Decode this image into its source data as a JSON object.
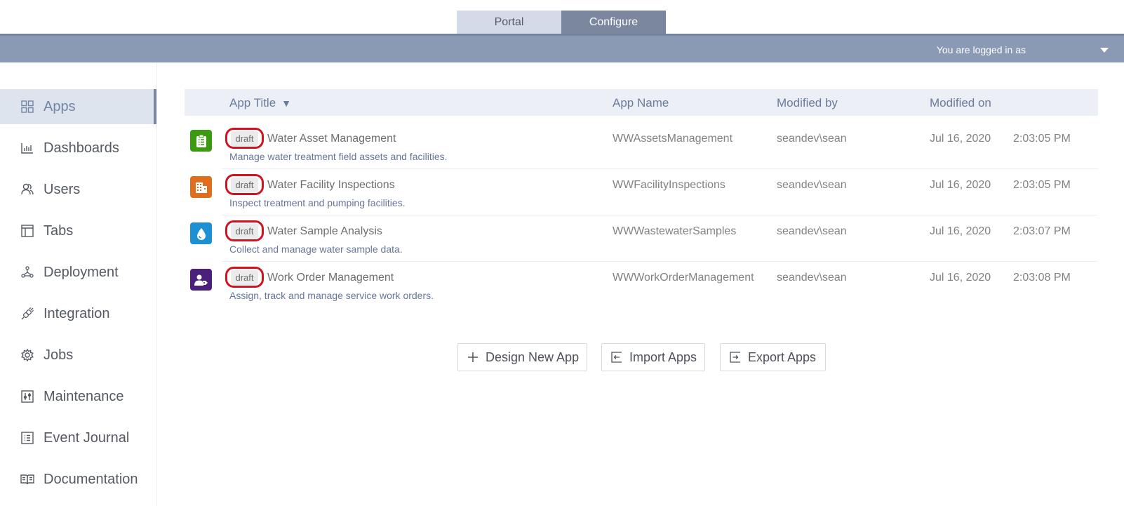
{
  "topnav": {
    "tabs": [
      {
        "label": "Portal",
        "active": false
      },
      {
        "label": "Configure",
        "active": true
      }
    ]
  },
  "header": {
    "login_text": "You are logged in as",
    "dropdown_icon": "caret-down-icon"
  },
  "sidebar": {
    "items": [
      {
        "label": "Apps",
        "icon": "grid-icon",
        "active": true
      },
      {
        "label": "Dashboards",
        "icon": "bar-chart-icon",
        "active": false
      },
      {
        "label": "Users",
        "icon": "users-icon",
        "active": false
      },
      {
        "label": "Tabs",
        "icon": "layout-icon",
        "active": false
      },
      {
        "label": "Deployment",
        "icon": "network-icon",
        "active": false
      },
      {
        "label": "Integration",
        "icon": "plug-icon",
        "active": false
      },
      {
        "label": "Jobs",
        "icon": "gear-icon",
        "active": false
      },
      {
        "label": "Maintenance",
        "icon": "sliders-icon",
        "active": false
      },
      {
        "label": "Event Journal",
        "icon": "list-icon",
        "active": false
      },
      {
        "label": "Documentation",
        "icon": "book-icon",
        "active": false
      }
    ]
  },
  "table": {
    "columns": {
      "title": "App Title",
      "title_sort": "▼",
      "name": "App Name",
      "modified_by": "Modified by",
      "modified_on": "Modified on"
    },
    "rows": [
      {
        "icon": "clipboard-list-icon",
        "color": "#3b9a0f",
        "badge": "draft",
        "title": "Water Asset Management",
        "description": "Manage water treatment field assets and facilities.",
        "app_name": "WWAssetsManagement",
        "modified_by": "seandev\\sean",
        "date": "Jul 16, 2020",
        "time": "2:03:05 PM"
      },
      {
        "icon": "building-icon",
        "color": "#e06e1d",
        "badge": "draft",
        "title": "Water Facility Inspections",
        "description": "Inspect treatment and pumping facilities.",
        "app_name": "WWFacilityInspections",
        "modified_by": "seandev\\sean",
        "date": "Jul 16, 2020",
        "time": "2:03:05 PM"
      },
      {
        "icon": "water-drop-icon",
        "color": "#1d8fd3",
        "badge": "draft",
        "title": "Water Sample Analysis",
        "description": "Collect and manage water sample data.",
        "app_name": "WWWastewaterSamples",
        "modified_by": "seandev\\sean",
        "date": "Jul 16, 2020",
        "time": "2:03:07 PM"
      },
      {
        "icon": "user-tag-icon",
        "color": "#4b1f7c",
        "badge": "draft",
        "title": "Work Order Management",
        "description": "Assign, track and manage service work orders.",
        "app_name": "WWWorkOrderManagement",
        "modified_by": "seandev\\sean",
        "date": "Jul 16, 2020",
        "time": "2:03:08 PM"
      }
    ]
  },
  "actions": {
    "design_new_app": "Design New App",
    "import_apps": "Import Apps",
    "export_apps": "Export Apps"
  },
  "colors": {
    "header_bar": "#8a9ab4",
    "active_tab": "#7a879f",
    "highlight_ring": "#d3121f"
  }
}
